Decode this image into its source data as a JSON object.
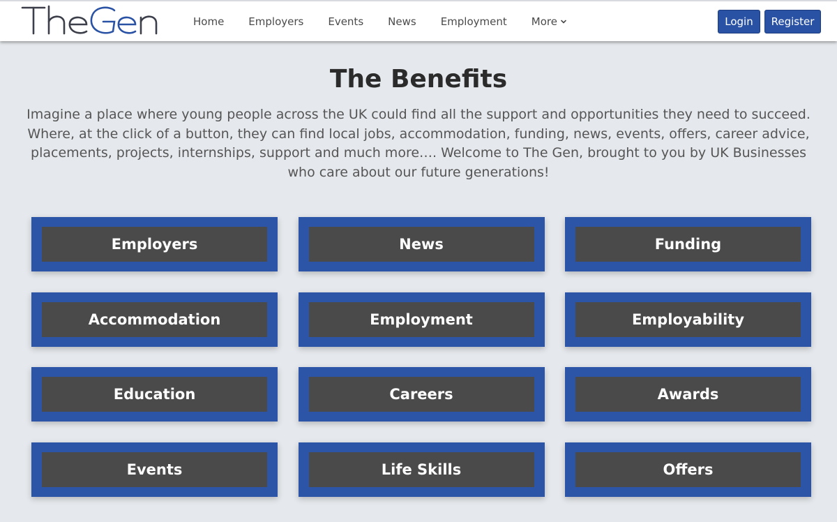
{
  "brand": {
    "logo_text": "TheGen",
    "logo_color": "#3c3f4a",
    "logo_accent": "#2a52a4"
  },
  "nav": {
    "items": [
      {
        "label": "Home"
      },
      {
        "label": "Employers"
      },
      {
        "label": "Events"
      },
      {
        "label": "News"
      },
      {
        "label": "Employment"
      },
      {
        "label": "More",
        "icon": "chevron-down-icon"
      }
    ]
  },
  "auth": {
    "login_label": "Login",
    "register_label": "Register"
  },
  "main": {
    "title": "The Benefits",
    "intro": "Imagine a place where young people across the UK could find all the support and opportunities they need to succeed. Where, at the click of a button, they can find local jobs, accommodation, funding, news, events, offers, career advice, placements, projects, internships, support and much more…. Welcome to The Gen, brought to you by UK Businesses who care about our future generations!",
    "tiles": [
      {
        "label": "Employers"
      },
      {
        "label": "News"
      },
      {
        "label": "Funding"
      },
      {
        "label": "Accommodation"
      },
      {
        "label": "Employment"
      },
      {
        "label": "Employability"
      },
      {
        "label": "Education"
      },
      {
        "label": "Careers"
      },
      {
        "label": "Awards"
      },
      {
        "label": "Events"
      },
      {
        "label": "Life Skills"
      },
      {
        "label": "Offers"
      }
    ]
  },
  "colors": {
    "page_background": "#e5e8ec",
    "primary_blue": "#2a52a4",
    "tile_border": "#2c55a8",
    "tile_fill": "#4a4a4a"
  }
}
